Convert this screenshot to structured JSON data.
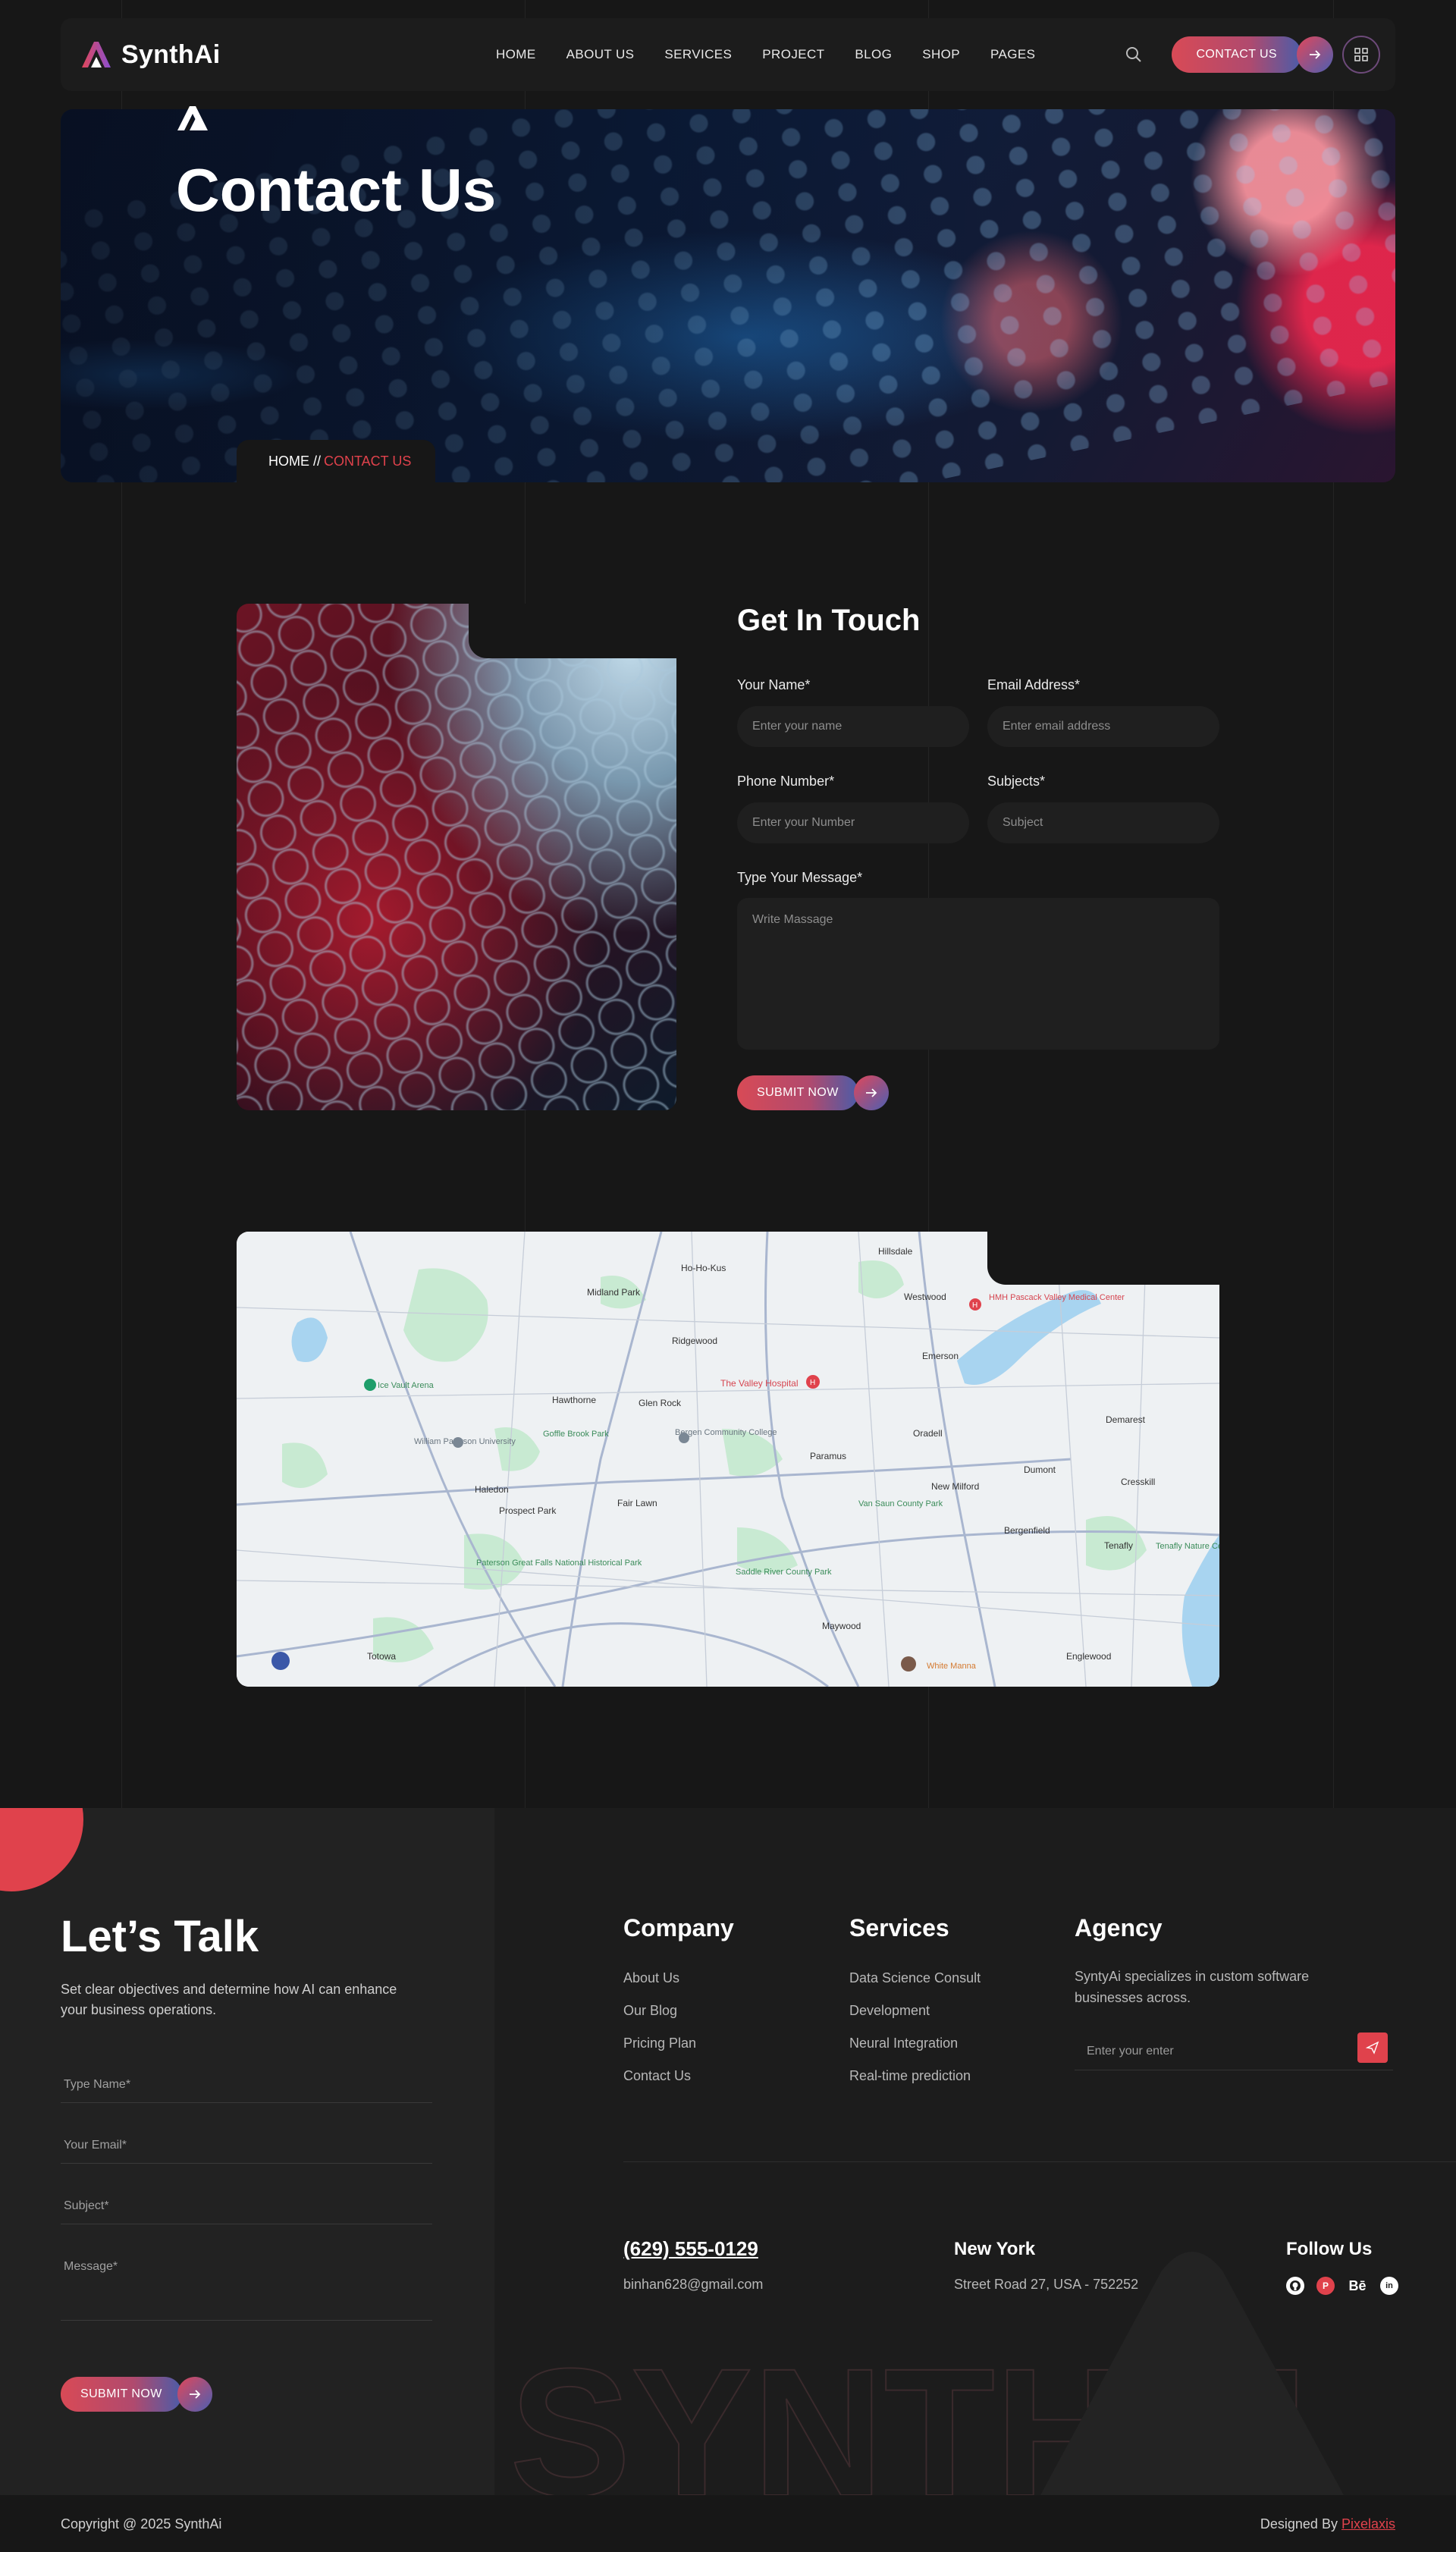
{
  "brand": {
    "name": "SynthAi"
  },
  "nav": {
    "items": [
      "HOME",
      "ABOUT US",
      "SERVICES",
      "PROJECT",
      "BLOG",
      "SHOP",
      "PAGES"
    ]
  },
  "header": {
    "contact_label": "CONTACT US"
  },
  "hero": {
    "title": "Contact Us",
    "crumb_home": "HOME //",
    "crumb_current": "CONTACT US"
  },
  "form": {
    "title": "Get In Touch",
    "name_label": "Your Name*",
    "name_placeholder": "Enter your name",
    "email_label": "Email Address*",
    "email_placeholder": "Enter email address",
    "phone_label": "Phone Number*",
    "phone_placeholder": "Enter your Number",
    "subject_label": "Subjects*",
    "subject_placeholder": "Subject",
    "message_label": "Type Your Message*",
    "message_placeholder": "Write Massage",
    "submit_label": "SUBMIT NOW"
  },
  "map": {
    "places": [
      "Ho-Ho-Kus",
      "Hillsdale",
      "Midland Park",
      "Westwood",
      "HMH Pascack Valley Medical Center",
      "Ridgewood",
      "Emerson",
      "The Valley Hospital",
      "Hawthorne",
      "Glen Rock",
      "Bergen Community College",
      "Oradell",
      "Demarest",
      "Paramus",
      "Dumont",
      "Cresskill",
      "Haledon",
      "Fair Lawn",
      "New Milford",
      "Prospect Park",
      "Van Saun County Park",
      "Bergenfield",
      "Tenafly",
      "Saddle River County Park",
      "Maywood",
      "Englewood",
      "Totowa",
      "White Manna",
      "William Paterson University",
      "Goffle Brook Park",
      "Paterson Great Falls National Historical Park",
      "Tenafly Nature Center",
      "Ice Vault Arena"
    ]
  },
  "footer": {
    "lets_talk": "Let’s Talk",
    "lets_text": "Set clear objectives and determine how AI can enhance your business operations.",
    "fields": [
      "Type Name*",
      "Your Email*",
      "Subject*",
      "Message*"
    ],
    "submit_label": "SUBMIT NOW",
    "company": {
      "title": "Company",
      "links": [
        "About Us",
        "Our Blog",
        "Pricing Plan",
        "Contact Us"
      ]
    },
    "services": {
      "title": "Services",
      "links": [
        "Data Science Consult",
        "Development",
        "Neural Integration",
        "Real-time prediction"
      ]
    },
    "agency": {
      "title": "Agency",
      "text": "SyntyAi specializes in custom software businesses across.",
      "placeholder": "Enter your enter"
    },
    "phone": "(629) 555-0129",
    "email": "binhan628@gmail.com",
    "city": "New York",
    "address": "Street Road 27, USA - 752252",
    "follow": "Follow Us",
    "watermark": "SYNTHAI",
    "copyright": "Copyright @ 2025 SynthAi",
    "designed_by": "Designed By",
    "designer": "Pixelaxis"
  },
  "colors": {
    "accent": "#e0424c",
    "accent_blue": "#4b5ca8",
    "bg": "#171717"
  }
}
